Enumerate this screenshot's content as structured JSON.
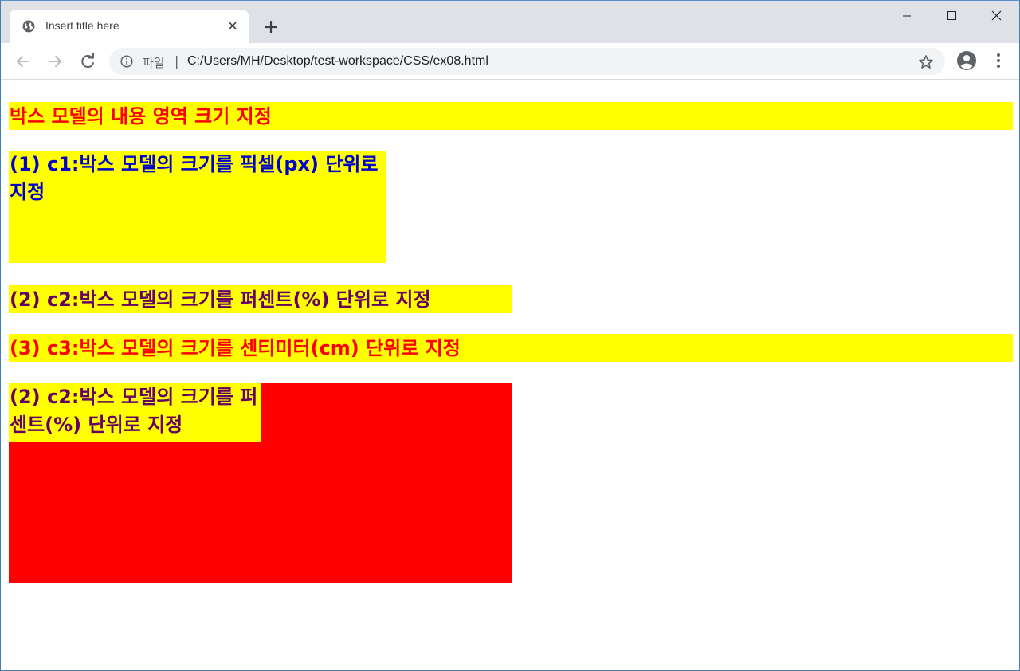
{
  "browser": {
    "tab": {
      "title": "Insert title here",
      "close_glyph": "✕"
    },
    "new_tab_icon": "plus-icon",
    "window_controls": [
      "minimize-icon",
      "maximize-icon",
      "close-icon"
    ],
    "nav": {
      "back_icon": "arrow-left-icon",
      "forward_icon": "arrow-right-icon",
      "reload_icon": "reload-icon"
    },
    "address": {
      "info_icon": "info-icon",
      "scheme_label": "파일",
      "separator": "|",
      "url": "C:/Users/MH/Desktop/test-workspace/CSS/ex08.html"
    },
    "bookmark_icon": "star-icon",
    "profile_icon": "account-circle-icon",
    "menu_icon": "kebab-menu-icon"
  },
  "page": {
    "heading": "박스 모델의 내용 영역 크기 지정",
    "c1_text": "(1) c1:박스 모델의 크기를 픽셀(px) 단위로 지정",
    "c2_text": "(2) c2:박스 모델의 크기를 퍼센트(%) 단위로 지정",
    "c3_text": "(3) c3:박스 모델의 크기를 센티미터(cm) 단위로 지정",
    "nested_text": "(2) c2:박스 모델의 크기를 퍼센트(%) 단위로 지정"
  },
  "colors": {
    "highlight": "#ffff00",
    "red": "#ff0000",
    "blue": "#0000cc",
    "purple": "#660066",
    "tabstrip": "#dee1e6",
    "omnibox": "#f1f3f4"
  }
}
